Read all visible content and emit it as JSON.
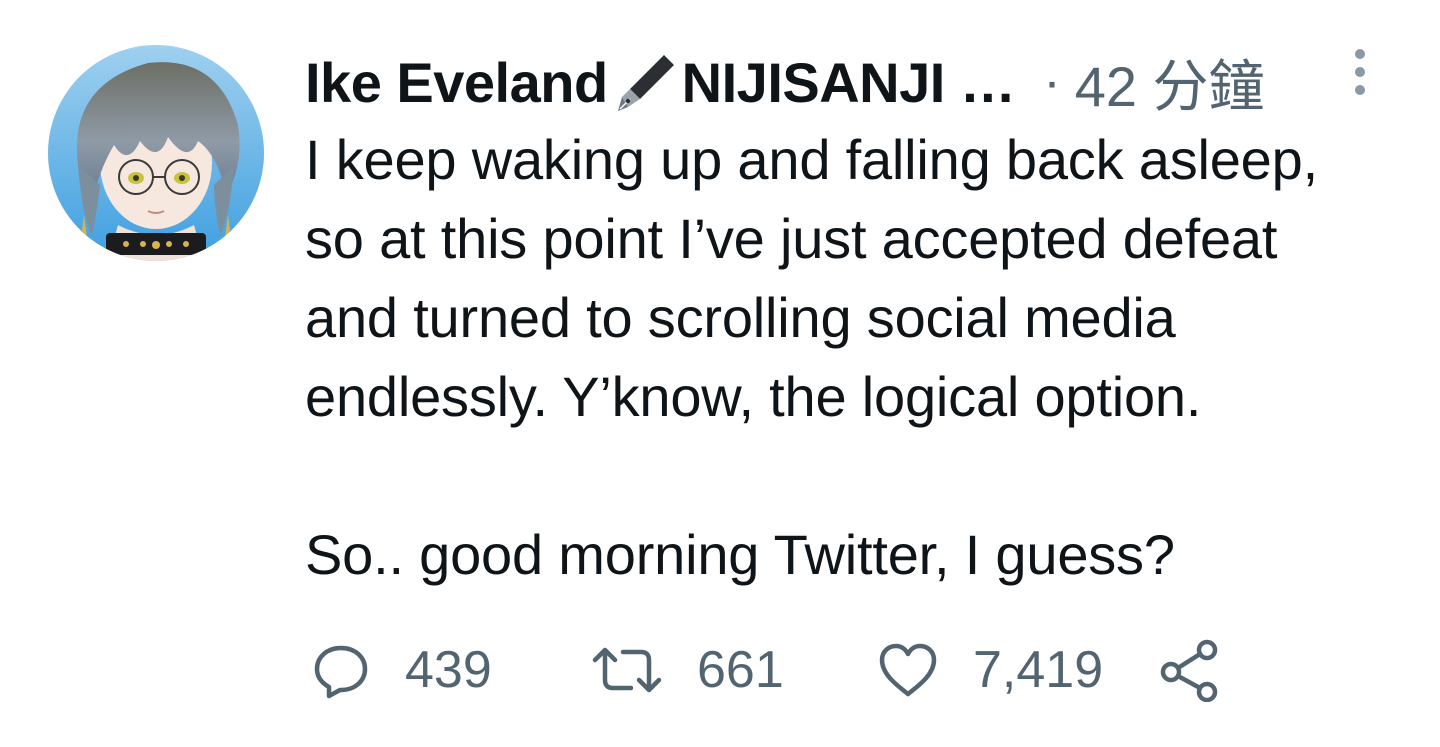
{
  "tweet": {
    "author": {
      "display_name": "Ike Eveland",
      "name_suffix": "NIJISANJI …",
      "badge_icon": "fountain-pen-icon",
      "avatar_alt": "Ike Eveland avatar"
    },
    "separator": "·",
    "timestamp": "42 分鐘",
    "text_lines": [
      "I keep waking up and falling back asleep,",
      "so at this point I’ve just accepted defeat",
      "and turned to scrolling social media",
      "endlessly. Y’know, the logical option."
    ],
    "text_lines_after_break": [
      "So.. good morning Twitter, I guess?"
    ],
    "actions": {
      "reply_count": "439",
      "retweet_count": "661",
      "like_count": "7,419"
    }
  },
  "colors": {
    "text_primary": "#0f1419",
    "text_secondary": "#536471",
    "background": "#ffffff"
  }
}
